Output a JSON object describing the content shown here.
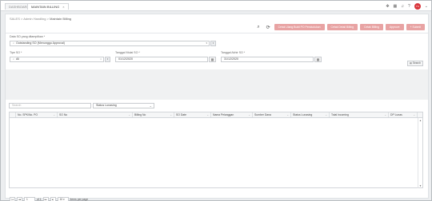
{
  "tabs": [
    {
      "label": "DASHBOARD",
      "active": false
    },
    {
      "label": "MAINTAIN BILLING",
      "active": true
    }
  ],
  "tab_close": "×",
  "top_icons": [
    "move-icon",
    "grid-icon",
    "bell-icon",
    "help-icon"
  ],
  "avatar": "TS",
  "breadcrumb": {
    "part1": "SALES",
    "part2": "Admin Handling",
    "current": "Maintain Billing",
    "sep": ">"
  },
  "toolbar": {
    "buttons": [
      "Cetak Ulang Bukti PO Pendudukan",
      "Cetak Detail Billing",
      "Cetak Billing",
      "Approve",
      "+ Submit"
    ]
  },
  "filters": {
    "data_so_label": "Data SO yang ditampilkan *",
    "data_so_value": "Outstanding SO (Menunggu Approval)",
    "tipe_so_label": "Tipe SO *",
    "tipe_so_value": "All",
    "tgl_mulai_label": "Tanggal Mulai SO *",
    "tgl_mulai_value": "01/12/2020",
    "tgl_akhir_label": "Tanggal Akhir SO *",
    "tgl_akhir_value": "31/12/2020",
    "search_button": "Search"
  },
  "grid_tools": {
    "search_placeholder": "Search",
    "status_select": "Status Lunasing"
  },
  "columns": [
    "No. SPK/No. PO",
    "SO No",
    "Billing No",
    "SO Date",
    "Nama Pelanggan",
    "Sumber Dana",
    "Status Lunasing",
    "Total Incoming",
    "DP Lunas"
  ],
  "pager": {
    "page": "1",
    "of_label": "of 1",
    "per_page": "10",
    "per_page_label": "items per page"
  },
  "colors": {
    "accent": "#d9353b",
    "button": "#e8a3a3"
  }
}
